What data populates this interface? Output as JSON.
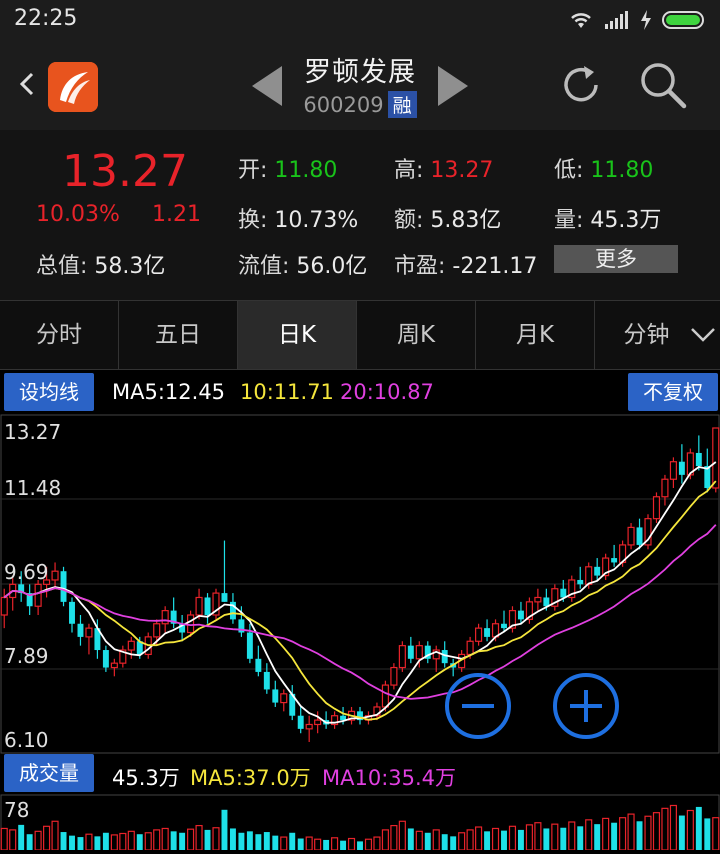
{
  "status": {
    "time": "22:25"
  },
  "header": {
    "stock_name": "罗顿发展",
    "code": "600209",
    "badge": "融"
  },
  "quote": {
    "price": "13.27",
    "change_pct": "10.03%",
    "change": "1.21",
    "open_label": "开:",
    "open": "11.80",
    "high_label": "高:",
    "high": "13.27",
    "low_label": "低:",
    "low": "11.80",
    "turnover_label": "换:",
    "turnover": "10.73%",
    "amount_label": "额:",
    "amount": "5.83亿",
    "volume_label": "量:",
    "volume": "45.3万",
    "total_value_label": "总值:",
    "total_value": "58.3亿",
    "float_value_label": "流值:",
    "float_value": "56.0亿",
    "pe_label": "市盈:",
    "pe": "-221.17",
    "more_label": "更多"
  },
  "tabs": [
    "分时",
    "五日",
    "日K",
    "周K",
    "月K",
    "分钟"
  ],
  "active_tab": 2,
  "ma_bar": {
    "set_ma_label": "设均线",
    "ma5": "MA5:12.45",
    "ma10": "10:11.71",
    "ma20": "20:10.87",
    "adjust_label": "不复权"
  },
  "colors": {
    "up": "#e8232a",
    "down": "#1ee0e8",
    "ma5": "#ffffff",
    "ma10": "#f5e63c",
    "ma20": "#e040e0",
    "accent": "#2b63c6"
  },
  "chart_data": {
    "type": "candlestick",
    "y_axis_labels": [
      "13.27",
      "11.48",
      "9.69",
      "7.89",
      "6.10"
    ],
    "ylim": [
      6.1,
      13.27
    ],
    "candles": [
      [
        9.0,
        9.6,
        8.7,
        9.4
      ],
      [
        9.4,
        9.9,
        9.1,
        9.7
      ],
      [
        9.7,
        10.0,
        9.3,
        9.5
      ],
      [
        9.5,
        9.7,
        9.0,
        9.2
      ],
      [
        9.2,
        9.8,
        9.0,
        9.7
      ],
      [
        9.7,
        10.1,
        9.4,
        9.8
      ],
      [
        9.8,
        10.2,
        9.6,
        10.0
      ],
      [
        10.0,
        10.1,
        9.2,
        9.3
      ],
      [
        9.3,
        9.4,
        8.6,
        8.8
      ],
      [
        8.8,
        9.0,
        8.3,
        8.5
      ],
      [
        8.5,
        8.8,
        8.1,
        8.7
      ],
      [
        8.7,
        8.9,
        8.0,
        8.2
      ],
      [
        8.2,
        8.3,
        7.7,
        7.8
      ],
      [
        7.8,
        8.0,
        7.6,
        7.9
      ],
      [
        7.9,
        8.3,
        7.8,
        8.2
      ],
      [
        8.2,
        8.5,
        8.0,
        8.4
      ],
      [
        8.4,
        8.5,
        8.0,
        8.1
      ],
      [
        8.1,
        8.6,
        8.0,
        8.5
      ],
      [
        8.5,
        8.9,
        8.3,
        8.8
      ],
      [
        8.8,
        9.2,
        8.6,
        9.1
      ],
      [
        9.1,
        9.4,
        8.7,
        8.8
      ],
      [
        8.8,
        9.0,
        8.4,
        8.6
      ],
      [
        8.6,
        9.1,
        8.5,
        9.0
      ],
      [
        9.0,
        9.6,
        8.9,
        9.4
      ],
      [
        9.4,
        9.5,
        8.8,
        9.0
      ],
      [
        9.0,
        9.6,
        8.9,
        9.5
      ],
      [
        9.5,
        10.7,
        9.3,
        9.3
      ],
      [
        9.3,
        9.5,
        8.8,
        8.9
      ],
      [
        8.9,
        9.2,
        8.5,
        8.6
      ],
      [
        8.6,
        8.8,
        7.9,
        8.0
      ],
      [
        8.0,
        8.3,
        7.6,
        7.7
      ],
      [
        7.7,
        7.9,
        7.2,
        7.3
      ],
      [
        7.3,
        7.5,
        6.9,
        7.0
      ],
      [
        7.0,
        7.3,
        6.8,
        7.2
      ],
      [
        7.2,
        7.4,
        6.6,
        6.7
      ],
      [
        6.7,
        6.9,
        6.3,
        6.4
      ],
      [
        6.4,
        6.7,
        6.1,
        6.5
      ],
      [
        6.5,
        6.8,
        6.3,
        6.6
      ],
      [
        6.6,
        6.8,
        6.4,
        6.5
      ],
      [
        6.5,
        6.8,
        6.4,
        6.7
      ],
      [
        6.7,
        6.9,
        6.5,
        6.6
      ],
      [
        6.6,
        6.9,
        6.5,
        6.8
      ],
      [
        6.8,
        6.9,
        6.5,
        6.6
      ],
      [
        6.6,
        6.8,
        6.5,
        6.7
      ],
      [
        6.7,
        7.0,
        6.6,
        6.9
      ],
      [
        6.9,
        7.5,
        6.8,
        7.4
      ],
      [
        7.4,
        7.9,
        7.3,
        7.8
      ],
      [
        7.8,
        8.4,
        7.7,
        8.3
      ],
      [
        8.3,
        8.5,
        7.9,
        8.0
      ],
      [
        8.0,
        8.4,
        7.8,
        8.3
      ],
      [
        8.3,
        8.4,
        7.9,
        8.0
      ],
      [
        8.0,
        8.3,
        7.7,
        8.2
      ],
      [
        8.2,
        8.4,
        7.8,
        7.9
      ],
      [
        7.9,
        8.0,
        7.6,
        7.8
      ],
      [
        7.8,
        8.2,
        7.7,
        8.1
      ],
      [
        8.1,
        8.5,
        8.0,
        8.4
      ],
      [
        8.4,
        8.8,
        8.3,
        8.7
      ],
      [
        8.7,
        8.9,
        8.4,
        8.5
      ],
      [
        8.5,
        8.9,
        8.4,
        8.8
      ],
      [
        8.8,
        9.1,
        8.6,
        8.7
      ],
      [
        8.7,
        9.2,
        8.6,
        9.1
      ],
      [
        9.1,
        9.3,
        8.8,
        8.9
      ],
      [
        8.9,
        9.4,
        8.8,
        9.3
      ],
      [
        9.3,
        9.6,
        9.1,
        9.4
      ],
      [
        9.4,
        9.6,
        9.1,
        9.2
      ],
      [
        9.2,
        9.7,
        9.1,
        9.6
      ],
      [
        9.6,
        9.8,
        9.3,
        9.4
      ],
      [
        9.4,
        9.9,
        9.3,
        9.8
      ],
      [
        9.8,
        10.1,
        9.6,
        9.7
      ],
      [
        9.7,
        10.2,
        9.6,
        10.1
      ],
      [
        10.1,
        10.3,
        9.8,
        9.9
      ],
      [
        9.9,
        10.4,
        9.8,
        10.3
      ],
      [
        10.3,
        10.6,
        10.1,
        10.2
      ],
      [
        10.2,
        10.7,
        10.1,
        10.6
      ],
      [
        10.6,
        11.1,
        10.5,
        11.0
      ],
      [
        11.0,
        11.2,
        10.5,
        10.6
      ],
      [
        10.6,
        11.3,
        10.5,
        11.2
      ],
      [
        11.2,
        11.8,
        11.1,
        11.7
      ],
      [
        11.7,
        12.2,
        11.5,
        12.1
      ],
      [
        12.1,
        12.6,
        11.9,
        12.5
      ],
      [
        12.5,
        12.9,
        12.0,
        12.2
      ],
      [
        12.2,
        12.8,
        12.1,
        12.7
      ],
      [
        12.7,
        13.1,
        12.3,
        12.4
      ],
      [
        12.4,
        12.8,
        11.8,
        11.9
      ],
      [
        11.9,
        13.27,
        11.8,
        13.27
      ]
    ],
    "ma5_last": 12.45,
    "ma10_last": 11.71,
    "ma20_last": 10.87
  },
  "volume_bar": {
    "label": "成交量",
    "volume": "45.3万",
    "ma5": "MA5:37.0万",
    "ma10": "MA10:35.4万",
    "axis_top": "78"
  },
  "volume_data": [
    30,
    28,
    35,
    22,
    26,
    33,
    40,
    25,
    20,
    18,
    22,
    19,
    24,
    21,
    23,
    26,
    22,
    24,
    28,
    30,
    26,
    24,
    29,
    34,
    28,
    31,
    56,
    30,
    24,
    26,
    22,
    25,
    20,
    18,
    24,
    16,
    18,
    15,
    14,
    17,
    13,
    16,
    12,
    15,
    18,
    28,
    34,
    40,
    30,
    26,
    24,
    28,
    22,
    19,
    24,
    28,
    32,
    26,
    30,
    27,
    33,
    28,
    35,
    38,
    30,
    36,
    31,
    39,
    33,
    42,
    36,
    44,
    38,
    45,
    50,
    40,
    47,
    52,
    58,
    62,
    48,
    55,
    60,
    44,
    45
  ]
}
